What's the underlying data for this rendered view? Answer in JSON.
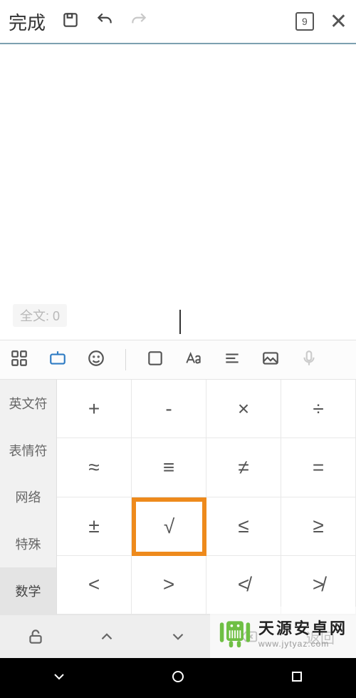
{
  "toolbar": {
    "done_label": "完成",
    "page_number": "9"
  },
  "editor": {
    "counter_prefix": "全文:",
    "counter_value": "0"
  },
  "categories": [
    "英文符",
    "表情符",
    "网络",
    "特殊",
    "数学"
  ],
  "selected_category_index": 4,
  "symbols": [
    [
      "+",
      "-",
      "×",
      "÷"
    ],
    [
      "≈",
      "≡",
      "≠",
      "="
    ],
    [
      "±",
      "√",
      "≤",
      "≥"
    ],
    [
      "<",
      ">",
      "≮",
      "≯"
    ]
  ],
  "highlight": {
    "row": 2,
    "col": 1
  },
  "ime_bottom": {
    "back_label": "返回"
  },
  "watermark": {
    "main": "天源安卓网",
    "sub": "www.jytyaz.com"
  }
}
